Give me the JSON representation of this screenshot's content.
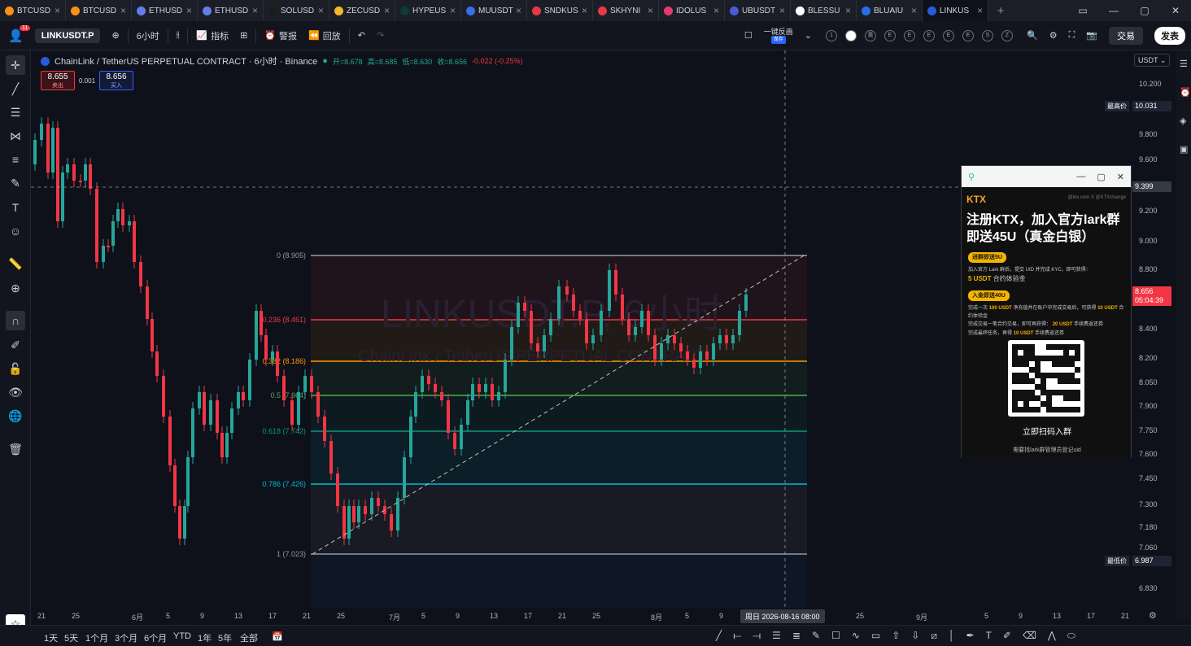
{
  "tabs": [
    {
      "label": "BTCUSD",
      "color": "#f7931a"
    },
    {
      "label": "BTCUSD",
      "color": "#f7931a"
    },
    {
      "label": "ETHUSD",
      "color": "#627eea"
    },
    {
      "label": "ETHUSD",
      "color": "#627eea"
    },
    {
      "label": "SOLUSD",
      "color": "#1b1b1b"
    },
    {
      "label": "ZECUSD",
      "color": "#f4b728"
    },
    {
      "label": "HYPEUS",
      "color": "#0b3b3b"
    },
    {
      "label": "MUUSDT",
      "color": "#3a6ee8"
    },
    {
      "label": "SNDKUS",
      "color": "#e63946"
    },
    {
      "label": "SKHYNI",
      "color": "#e63946"
    },
    {
      "label": "IDOLUS",
      "color": "#e63972"
    },
    {
      "label": "UBUSDT",
      "color": "#4a5bd6"
    },
    {
      "label": "BLESSU",
      "color": "#ffffff"
    },
    {
      "label": "BLUAIU",
      "color": "#2c6ce8"
    },
    {
      "label": "LINKUS",
      "color": "#2a5ada",
      "active": true
    }
  ],
  "toolbar": {
    "symbol": "LINKUSDT.P",
    "badge": "11",
    "interval": "6小时",
    "indicators": "指标",
    "alert": "警报",
    "replay": "回放",
    "layout_label": "一键反画",
    "layout_sub": "保存",
    "circles": [
      "1",
      "",
      "黄",
      "E",
      "E",
      "E",
      "E",
      "E",
      "S",
      "Z"
    ],
    "trade": "交易",
    "post": "发表"
  },
  "legend": {
    "title": "ChainLink / TetherUS PERPETUAL CONTRACT · 6小时 · Binance",
    "open_label": "开=8.678",
    "high_label": "高=8.685",
    "low_label": "低=8.630",
    "close_label": "收=8.656",
    "change": "-0.022 (-0.25%)",
    "sell_price": "8.655",
    "sell_label": "卖出",
    "spread": "0.001",
    "buy_price": "8.656",
    "buy_label": "买入"
  },
  "watermark": {
    "symbol": "LINKUSDT.P, 6小时",
    "name": "ChainLink / TetherUS PERPETUAL CONTRACT"
  },
  "price_axis": {
    "currency": "USDT",
    "ticks": [
      "10.200",
      "9.800",
      "9.600",
      "9.200",
      "9.000",
      "8.800",
      "8.600",
      "8.400",
      "8.200",
      "8.050",
      "7.900",
      "7.750",
      "7.600",
      "7.450",
      "7.300",
      "7.180",
      "7.060",
      "6.830"
    ],
    "high_label": "最高价",
    "high_value": "10.031",
    "crosshair_value": "9.399",
    "last_value": "8.656",
    "countdown": "05:04:39",
    "low_label": "最低价",
    "low_value": "6.987"
  },
  "fib": [
    {
      "label": "0 (8.905)",
      "color": "#9598a1"
    },
    {
      "label": "0.236 (8.461)",
      "color": "#f23645"
    },
    {
      "label": "0.382 (8.186)",
      "color": "#ff9800"
    },
    {
      "label": "0.5 (7.964)",
      "color": "#4caf50"
    },
    {
      "label": "0.618 (7.742)",
      "color": "#089981"
    },
    {
      "label": "0.786 (7.426)",
      "color": "#00bcd4"
    },
    {
      "label": "1 (7.023)",
      "color": "#9598a1"
    }
  ],
  "time_axis": {
    "ticks": [
      "21",
      "25",
      "6月",
      "5",
      "9",
      "13",
      "17",
      "21",
      "25",
      "7月",
      "5",
      "9",
      "13",
      "17",
      "21",
      "25",
      "8月",
      "5",
      "9",
      "25",
      "9月",
      "5",
      "9",
      "13",
      "17",
      "21",
      "25"
    ],
    "crosshair_label": "周日 2026-08-16  08:00"
  },
  "ranges": [
    "1天",
    "5天",
    "1个月",
    "3个月",
    "6个月",
    "YTD",
    "1年",
    "5年",
    "全部"
  ],
  "popup": {
    "logo": "KTX",
    "sub": "@ktx.com   X @KTXchange",
    "title": "注册KTX，加入官方lark群即送45U（真金白银）",
    "pill1": "进群即送5U",
    "line1": "加入官方 Lark 群后，提交 UID 并完成 KYC，即可获得：",
    "bonus1": "5 USDT",
    "bonus1_sub": "合约体验金",
    "pill2": "入金即送40U",
    "line2a": "完成一次",
    "amt100": "100 USDT",
    "line2b": "净充值并在账户中完成交易后，可获得",
    "amt10": "10 USDT",
    "line2c": "合约体验金",
    "line3a": "完成交易一笔合约交易，即可再获得：",
    "amt20": "20 USDT",
    "line3b": "手续费返还券",
    "line4a": "完成最终任务，再得",
    "amt10b": "10 USDT",
    "line4b": "手续费返还券",
    "scan": "立即扫码入群",
    "note": "需要找lark群管理员登记uid"
  }
}
